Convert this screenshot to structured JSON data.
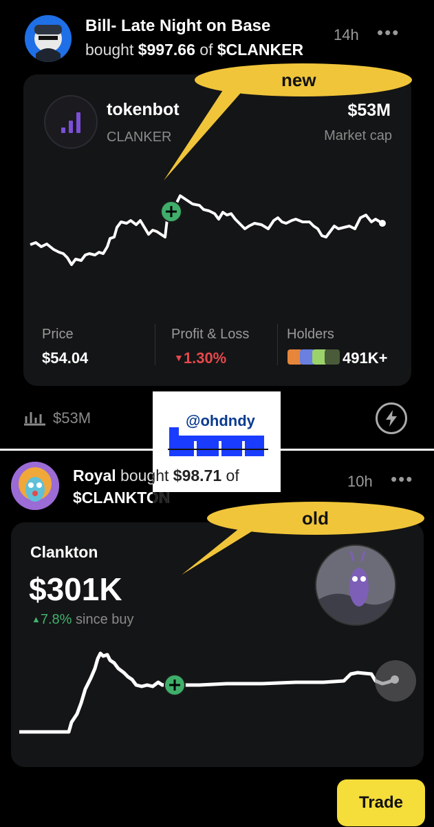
{
  "post1": {
    "author": "Bill- Late Night on Base",
    "action_prefix": "bought ",
    "amount": "$997.66",
    "action_mid": " of ",
    "token": "$CLANKER",
    "time": "14h",
    "more": "•••",
    "card": {
      "token_name": "tokenbot",
      "token_ticker": "CLANKER",
      "market_cap": "$53M",
      "market_cap_label": "Market cap",
      "stats": {
        "price_label": "Price",
        "price_value": "$54.04",
        "pnl_label": "Profit & Loss",
        "pnl_value": "1.30%",
        "holders_label": "Holders",
        "holders_value": "491K+"
      }
    },
    "footer_mcap": "$53M"
  },
  "post2": {
    "author": "Royal",
    "action_prefix": " bought ",
    "amount": "$98.71",
    "action_mid": " of",
    "token": "$CLANKTON",
    "time": "10h",
    "more": "•••",
    "card": {
      "token_name": "Clankton",
      "value": "$301K",
      "change": "7.8%",
      "change_suffix": " since buy"
    },
    "trade_label": "Trade"
  },
  "annotations": {
    "new": "new",
    "old": "old"
  },
  "watermark": {
    "handle": "@ohdndy"
  },
  "colors": {
    "trade_button": "#f5dd3a",
    "callout": "#f0c53a",
    "positive": "#3fb36d",
    "negative": "#e5484d",
    "buy_marker": "#3fae6b"
  }
}
